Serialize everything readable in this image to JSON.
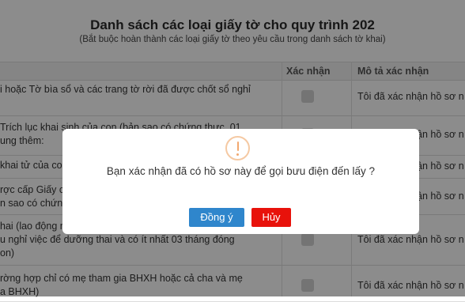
{
  "header": {
    "title": "Danh sách các loại giấy tờ cho quy trình 202",
    "subtitle": "(Bắt buộc hoàn thành các loại giấy tờ theo yêu cầu trong danh sách tờ khai)"
  },
  "table": {
    "columns": {
      "confirm": "Xác nhận",
      "description": "Mô tả xác nhận"
    },
    "rows": [
      {
        "lines": [
          "i hoặc Tờ bìa sổ và các trang tờ rời đã được chốt sổ nghỉ"
        ],
        "description": "Tôi đã xác nhận hồ sơ n"
      },
      {
        "lines": [
          " Trích lục khai sinh của con (bản sao có chứng thực, 01",
          "ung thêm:"
        ],
        "description": "Tôi đã xác nhận hồ sơ n"
      },
      {
        "lines": [
          " khai tử của co"
        ],
        "description": "Tôi đã xác nhận hồ sơ n"
      },
      {
        "lines": [
          "rợc cấp Giấy c",
          "n sao có chứn"
        ],
        "description": "Tôi đã xác nhận hồ sơ n"
      },
      {
        "lines": [
          "hai (lao động n",
          "u nghỉ việc để dưỡng thai và có ít nhất 03 tháng đóng",
          "on)"
        ],
        "description": "Tôi đã xác nhận hồ sơ n"
      },
      {
        "lines": [
          "rờng hợp chỉ có mẹ tham gia BHXH hoặc cả cha và mẹ",
          "a BHXH)"
        ],
        "description": "Tôi đã xác nhận hồ sơ n"
      }
    ]
  },
  "dialog": {
    "icon": "warning-icon",
    "message": "Bạn xác nhận đã có hồ sơ này để gọi bưu điện đến lấy ?",
    "confirm_label": "Đồng ý",
    "cancel_label": "Hủy"
  }
}
